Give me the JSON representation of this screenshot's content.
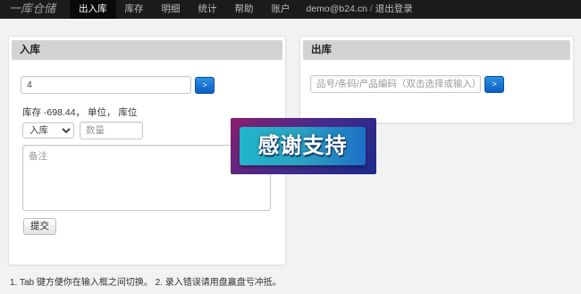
{
  "nav": {
    "brand": "一库仓储",
    "items": [
      {
        "label": "出入库",
        "active": true
      },
      {
        "label": "库存",
        "active": false
      },
      {
        "label": "明细",
        "active": false
      },
      {
        "label": "统计",
        "active": false
      },
      {
        "label": "帮助",
        "active": false
      },
      {
        "label": "账户",
        "active": false
      }
    ],
    "user_email": "demo@b24.cn",
    "separator": "/",
    "logout": "退出登录"
  },
  "inbound": {
    "title": "入库",
    "product_value": "4",
    "go_label": ">",
    "stock_text": "库存 -698.44， 单位， 库位",
    "type_selected": "入库",
    "qty_placeholder": "数量",
    "remark_placeholder": "备注",
    "submit_label": "提交"
  },
  "outbound": {
    "title": "出库",
    "product_placeholder": "品号/条码/产品编码（双击选择或输入）",
    "go_label": ">"
  },
  "overlay": {
    "text": "感谢支持"
  },
  "footer_hint": "1. Tab 键方便你在输入框之间切换。 2. 录入错误请用盘赢盘亏冲抵。",
  "colors": {
    "navbar": "#1b1b1b",
    "primary_button": "#0a5fc2",
    "panel_header": "#d3d3d3"
  }
}
